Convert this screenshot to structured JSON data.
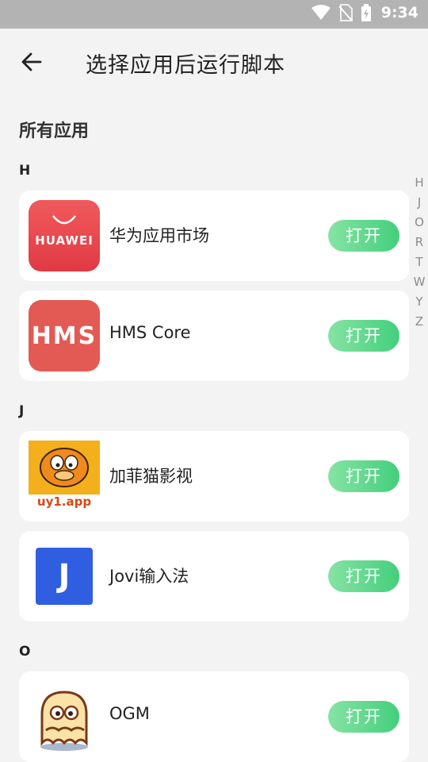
{
  "status": {
    "time": "9:34"
  },
  "header": {
    "title": "选择应用后运行脚本"
  },
  "section_title": "所有应用",
  "groups": [
    {
      "letter": "H",
      "apps": [
        {
          "name": "华为应用市场",
          "icon_text": "HUAWEI",
          "icon": "huawei-appgallery-icon"
        },
        {
          "name": "HMS Core",
          "icon_text": "HMS",
          "icon": "hms-core-icon"
        }
      ]
    },
    {
      "letter": "J",
      "apps": [
        {
          "name": "加菲猫影视",
          "icon_text": "uy1.app",
          "icon": "garfield-icon"
        },
        {
          "name": "Jovi输入法",
          "icon_text": "J",
          "icon": "jovi-icon"
        }
      ]
    },
    {
      "letter": "O",
      "apps": [
        {
          "name": "OGM",
          "icon": "ghost-icon"
        }
      ]
    }
  ],
  "open_label": "打开",
  "index_letters": [
    "H",
    "J",
    "O",
    "R",
    "T",
    "W",
    "Y",
    "Z"
  ],
  "colors": {
    "accent_green": "#43cf7c",
    "huawei_red": "#e8444a",
    "hms_red": "#e35a55",
    "jovi_blue": "#2f5fe0"
  }
}
